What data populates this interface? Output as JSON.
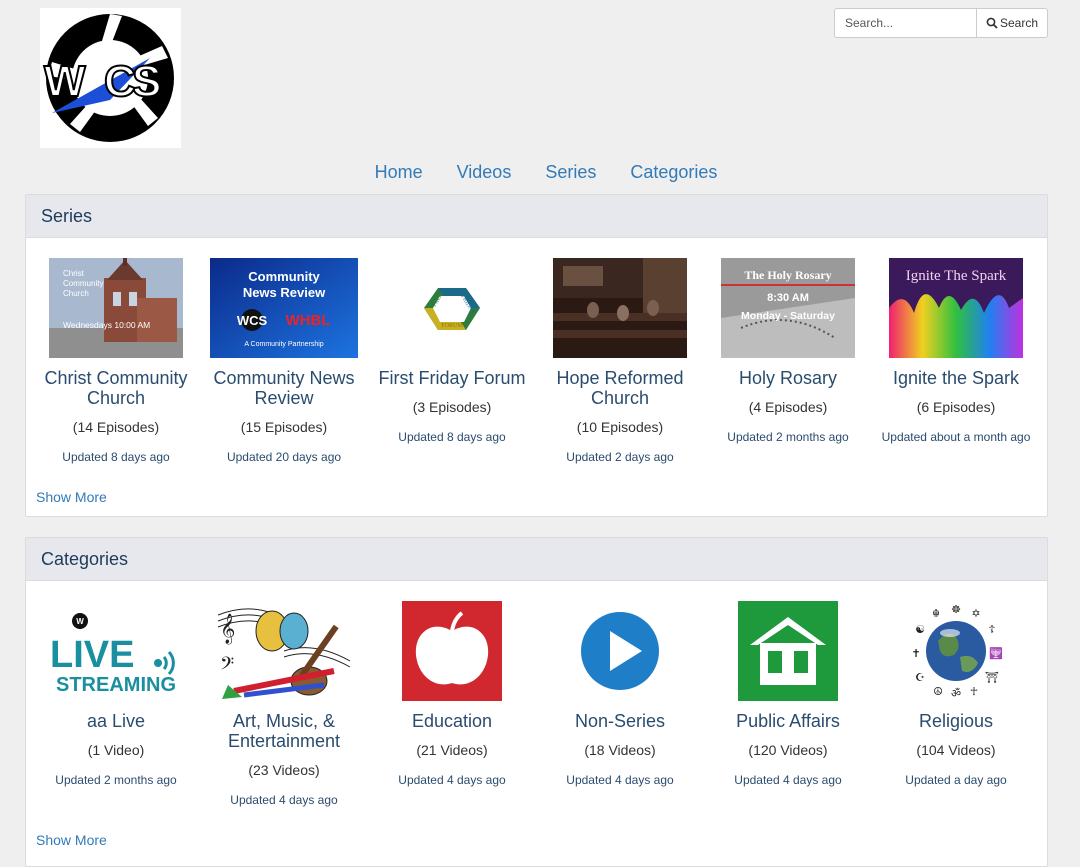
{
  "header": {
    "logo_text": "WCS",
    "search_placeholder": "Search...",
    "search_button_label": "Search"
  },
  "nav": {
    "items": [
      {
        "label": "Home"
      },
      {
        "label": "Videos"
      },
      {
        "label": "Series"
      },
      {
        "label": "Categories"
      }
    ]
  },
  "series": {
    "heading": "Series",
    "show_more": "Show More",
    "items": [
      {
        "title": "Christ Community Church",
        "count": "(14 Episodes)",
        "updated": "Updated 8 days ago",
        "thumb_text": [
          "Christ",
          "Community",
          "Church",
          "Wednesdays 10:00 AM"
        ]
      },
      {
        "title": "Community News Review",
        "count": "(15 Episodes)",
        "updated": "Updated 20 days ago",
        "thumb_text": [
          "Community",
          "News Review",
          "WCS",
          "WHBL",
          "A Community Partnership"
        ]
      },
      {
        "title": "First Friday Forum",
        "count": "(3 Episodes)",
        "updated": "Updated 8 days ago",
        "thumb_text": [
          "FIRST",
          "FRIDAY",
          "FORUM"
        ]
      },
      {
        "title": "Hope Reformed Church",
        "count": "(10 Episodes)",
        "updated": "Updated 2 days ago",
        "thumb_text": []
      },
      {
        "title": "Holy Rosary",
        "count": "(4 Episodes)",
        "updated": "Updated 2 months ago",
        "thumb_text": [
          "The Holy Rosary",
          "8:30 AM",
          "Monday - Saturday"
        ]
      },
      {
        "title": "Ignite the Spark",
        "count": "(6 Episodes)",
        "updated": "Updated about a month ago",
        "thumb_text": [
          "Ignite The Spark"
        ]
      }
    ]
  },
  "categories": {
    "heading": "Categories",
    "show_more": "Show More",
    "items": [
      {
        "title": "aa Live",
        "count": "(1 Video)",
        "updated": "Updated 2 months ago",
        "thumb_text": [
          "LIVE",
          "STREAMING"
        ]
      },
      {
        "title": "Art, Music, & Entertainment",
        "count": "(23 Videos)",
        "updated": "Updated 4 days ago",
        "thumb_text": []
      },
      {
        "title": "Education",
        "count": "(21 Videos)",
        "updated": "Updated 4 days ago",
        "thumb_text": []
      },
      {
        "title": "Non-Series",
        "count": "(18 Videos)",
        "updated": "Updated 4 days ago",
        "thumb_text": []
      },
      {
        "title": "Public Affairs",
        "count": "(120 Videos)",
        "updated": "Updated 4 days ago",
        "thumb_text": []
      },
      {
        "title": "Religious",
        "count": "(104 Videos)",
        "updated": "Updated a day ago",
        "thumb_text": []
      }
    ]
  },
  "colors": {
    "link": "#337ab7",
    "heading_bg": "#e6e8ee",
    "education_red": "#d0282e",
    "nonseries_blue": "#1e7ec8",
    "public_affairs_green": "#1e9a3c",
    "live_teal": "#1a8fa0"
  }
}
